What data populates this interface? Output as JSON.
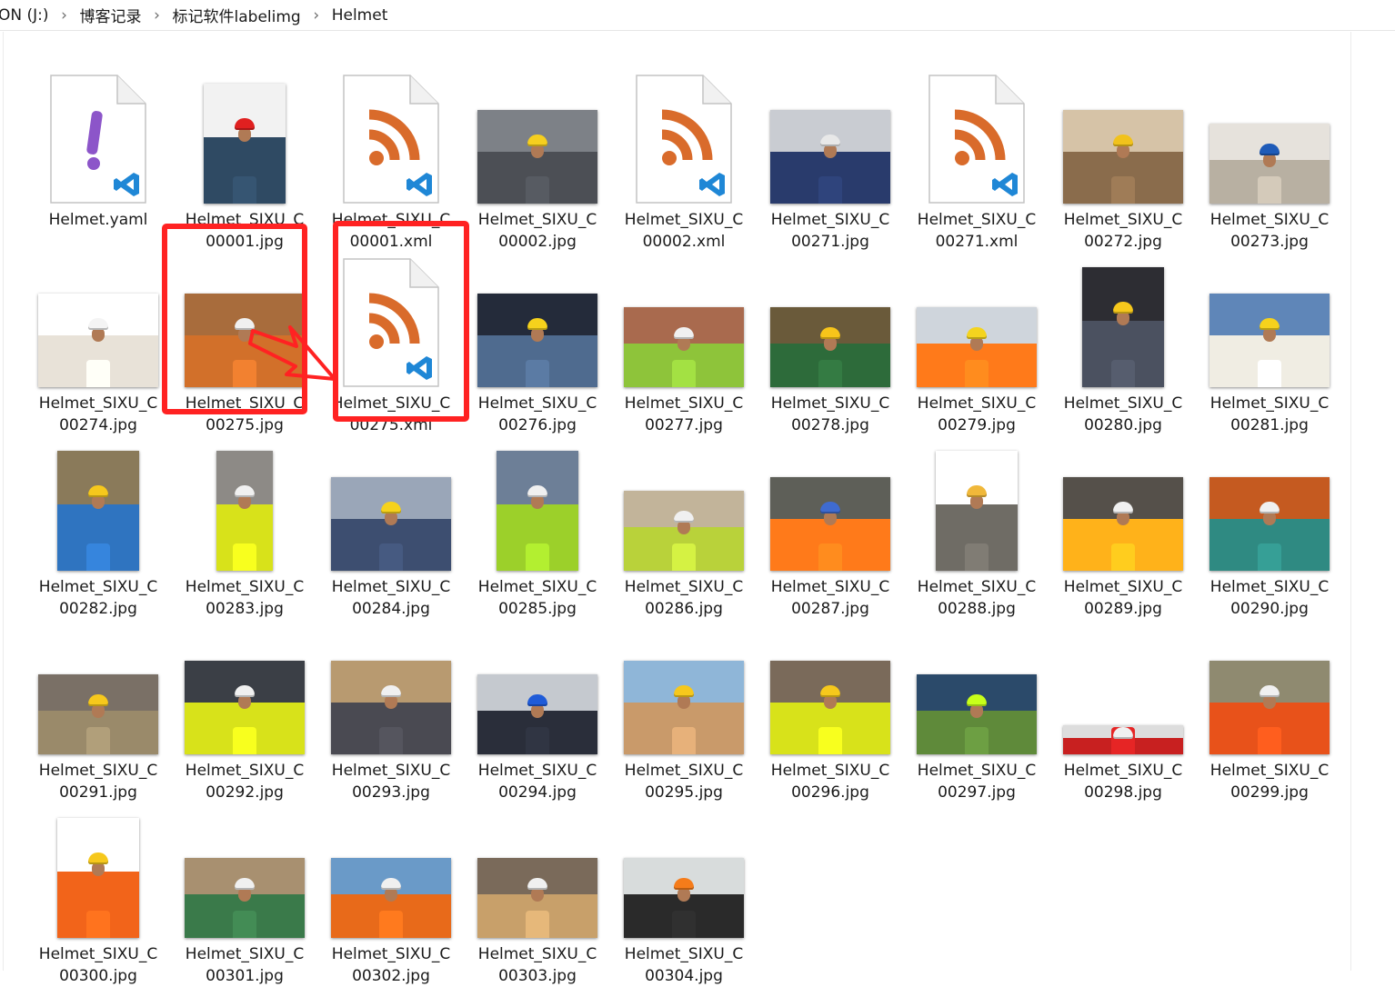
{
  "breadcrumb": [
    "ON (J:)",
    "博客记录",
    "标记软件labelimg",
    "Helmet"
  ],
  "breadcrumb_separator": "›",
  "colors": {
    "highlight": "#ff2222",
    "rss": "#d96b2b",
    "vscode": "#1f87d6",
    "yaml": "#8c55c9"
  },
  "files": [
    {
      "name": "Helmet.yaml",
      "kind": "yaml"
    },
    {
      "name": "Helmet_SIXU_C\n00001.jpg",
      "kind": "photo",
      "shape": "portrait",
      "bg": "#f2f2f2",
      "ground": "#2f4a63",
      "helmet": "#e02020"
    },
    {
      "name": "Helmet_SIXU_C\n00001.xml",
      "kind": "xml"
    },
    {
      "name": "Helmet_SIXU_C\n00002.jpg",
      "kind": "photo",
      "shape": "landscape",
      "bg": "#7d8187",
      "ground": "#4c4f55",
      "helmet": "#f6cf1f"
    },
    {
      "name": "Helmet_SIXU_C\n00002.xml",
      "kind": "xml"
    },
    {
      "name": "Helmet_SIXU_C\n00271.jpg",
      "kind": "photo",
      "shape": "landscape",
      "bg": "#c9ccd2",
      "ground": "#293b6c",
      "helmet": "#e8e8e8"
    },
    {
      "name": "Helmet_SIXU_C\n00271.xml",
      "kind": "xml"
    },
    {
      "name": "Helmet_SIXU_C\n00272.jpg",
      "kind": "photo",
      "shape": "landscape",
      "bg": "#d6c3a7",
      "ground": "#8a6c4c",
      "helmet": "#f1c21c"
    },
    {
      "name": "Helmet_SIXU_C\n00273.jpg",
      "kind": "photo",
      "shape": "wide",
      "bg": "#e6e2dc",
      "ground": "#b8b0a2",
      "helmet": "#1f5bb8"
    },
    {
      "name": "Helmet_SIXU_C\n00274.jpg",
      "kind": "photo",
      "shape": "landscape",
      "bg": "#ffffff",
      "ground": "#e8e2d8",
      "helmet": "#f4f4f4"
    },
    {
      "name": "Helmet_SIXU_C\n00275.jpg",
      "kind": "photo",
      "shape": "landscape",
      "bg": "#a86c3c",
      "ground": "#d2702a",
      "helmet": "#f0f0f0"
    },
    {
      "name": "Helmet_SIXU_C\n00275.xml",
      "kind": "xml"
    },
    {
      "name": "Helmet_SIXU_C\n00276.jpg",
      "kind": "photo",
      "shape": "landscape",
      "bg": "#242b3a",
      "ground": "#4f6b8f",
      "helmet": "#f6d21c"
    },
    {
      "name": "Helmet_SIXU_C\n00277.jpg",
      "kind": "photo",
      "shape": "wide",
      "bg": "#a96a4e",
      "ground": "#8ec43a",
      "helmet": "#f0f0f0"
    },
    {
      "name": "Helmet_SIXU_C\n00278.jpg",
      "kind": "photo",
      "shape": "wide",
      "bg": "#6a5a3a",
      "ground": "#2d6b3a",
      "helmet": "#f7c51a"
    },
    {
      "name": "Helmet_SIXU_C\n00279.jpg",
      "kind": "photo",
      "shape": "wide",
      "bg": "#cfd5dc",
      "ground": "#ff7a1a",
      "helmet": "#f4d41f"
    },
    {
      "name": "Helmet_SIXU_C\n00280.jpg",
      "kind": "photo",
      "shape": "portrait",
      "bg": "#2d2d33",
      "ground": "#4b5160",
      "helmet": "#f6c81c"
    },
    {
      "name": "Helmet_SIXU_C\n00281.jpg",
      "kind": "photo",
      "shape": "landscape",
      "bg": "#5f86b8",
      "ground": "#f0ede3",
      "helmet": "#f6d21c"
    },
    {
      "name": "Helmet_SIXU_C\n00282.jpg",
      "kind": "photo",
      "shape": "portrait",
      "bg": "#8a7a5a",
      "ground": "#2f74c0",
      "helmet": "#f6c81c"
    },
    {
      "name": "Helmet_SIXU_C\n00283.jpg",
      "kind": "photo",
      "shape": "tall",
      "bg": "#8d8a86",
      "ground": "#d8e21a",
      "helmet": "#f0f0f0"
    },
    {
      "name": "Helmet_SIXU_C\n00284.jpg",
      "kind": "photo",
      "shape": "landscape",
      "bg": "#9aa6b8",
      "ground": "#3d4e70",
      "helmet": "#f6d21c"
    },
    {
      "name": "Helmet_SIXU_C\n00285.jpg",
      "kind": "photo",
      "shape": "portrait",
      "bg": "#6d7f97",
      "ground": "#9cd02a",
      "helmet": "#f0f0f0"
    },
    {
      "name": "Helmet_SIXU_C\n00286.jpg",
      "kind": "photo",
      "shape": "wide",
      "bg": "#c2b49a",
      "ground": "#b9d23a",
      "helmet": "#f0f0f0"
    },
    {
      "name": "Helmet_SIXU_C\n00287.jpg",
      "kind": "photo",
      "shape": "landscape",
      "bg": "#5e5f58",
      "ground": "#ff7a1a",
      "helmet": "#3f6bd0"
    },
    {
      "name": "Helmet_SIXU_C\n00288.jpg",
      "kind": "photo",
      "shape": "portrait",
      "bg": "#ffffff",
      "ground": "#6f6c65",
      "helmet": "#f0b83a"
    },
    {
      "name": "Helmet_SIXU_C\n00289.jpg",
      "kind": "photo",
      "shape": "landscape",
      "bg": "#55504a",
      "ground": "#ffb21a",
      "helmet": "#f0f0f0"
    },
    {
      "name": "Helmet_SIXU_C\n00290.jpg",
      "kind": "photo",
      "shape": "landscape",
      "bg": "#c55a20",
      "ground": "#2f8a82",
      "helmet": "#f0f0f0"
    },
    {
      "name": "Helmet_SIXU_C\n00291.jpg",
      "kind": "photo",
      "shape": "wide",
      "bg": "#7a7066",
      "ground": "#9a8a6a",
      "helmet": "#f6c81c"
    },
    {
      "name": "Helmet_SIXU_C\n00292.jpg",
      "kind": "photo",
      "shape": "landscape",
      "bg": "#3b3f46",
      "ground": "#d8e21a",
      "helmet": "#f0f0f0"
    },
    {
      "name": "Helmet_SIXU_C\n00293.jpg",
      "kind": "photo",
      "shape": "landscape",
      "bg": "#b89a70",
      "ground": "#4a4a52",
      "helmet": "#f0f0f0"
    },
    {
      "name": "Helmet_SIXU_C\n00294.jpg",
      "kind": "photo",
      "shape": "wide",
      "bg": "#c5c9cf",
      "ground": "#2a2e3a",
      "helmet": "#1f5bd8"
    },
    {
      "name": "Helmet_SIXU_C\n00295.jpg",
      "kind": "photo",
      "shape": "landscape",
      "bg": "#8fb6d8",
      "ground": "#c99a6a",
      "helmet": "#f6c81c"
    },
    {
      "name": "Helmet_SIXU_C\n00296.jpg",
      "kind": "photo",
      "shape": "landscape",
      "bg": "#7a6a5a",
      "ground": "#d8e21a",
      "helmet": "#f6c81c"
    },
    {
      "name": "Helmet_SIXU_C\n00297.jpg",
      "kind": "photo",
      "shape": "wide",
      "bg": "#2b4a6a",
      "ground": "#5f8a3a",
      "helmet": "#c8ff1a"
    },
    {
      "name": "Helmet_SIXU_C\n00298.jpg",
      "kind": "photo",
      "shape": "short",
      "bg": "#dddddd",
      "ground": "#c82020",
      "helmet": "#f0f0f0"
    },
    {
      "name": "Helmet_SIXU_C\n00299.jpg",
      "kind": "photo",
      "shape": "landscape",
      "bg": "#8f8a70",
      "ground": "#e8521a",
      "helmet": "#f0f0f0"
    },
    {
      "name": "Helmet_SIXU_C\n00300.jpg",
      "kind": "photo",
      "shape": "portrait",
      "bg": "#ffffff",
      "ground": "#f2641a",
      "helmet": "#f6c81c"
    },
    {
      "name": "Helmet_SIXU_C\n00301.jpg",
      "kind": "photo",
      "shape": "wide",
      "bg": "#a89070",
      "ground": "#3a7a4a",
      "helmet": "#f0f0f0"
    },
    {
      "name": "Helmet_SIXU_C\n00302.jpg",
      "kind": "photo",
      "shape": "wide",
      "bg": "#6a9ac8",
      "ground": "#e86a1a",
      "helmet": "#f0f0f0"
    },
    {
      "name": "Helmet_SIXU_C\n00303.jpg",
      "kind": "photo",
      "shape": "wide",
      "bg": "#7a6a5a",
      "ground": "#c8a06a",
      "helmet": "#f0f0f0"
    },
    {
      "name": "Helmet_SIXU_C\n00304.jpg",
      "kind": "photo",
      "shape": "wide",
      "bg": "#d8dcdc",
      "ground": "#2a2a2a",
      "helmet": "#f57c1a"
    }
  ],
  "annotations": {
    "highlighted_files": [
      "Helmet_SIXU_C\n00275.jpg",
      "Helmet_SIXU_C\n00275.xml"
    ],
    "arrow": "jpg → xml"
  }
}
